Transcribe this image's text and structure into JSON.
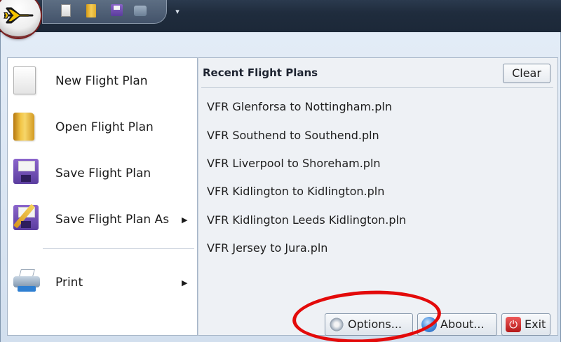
{
  "quick_access": {
    "icons": [
      "new-document-icon",
      "open-folder-icon",
      "save-disk-icon",
      "print-icon"
    ],
    "dropdown_glyph": "▾"
  },
  "app_button": {
    "icon": "airplane-icon"
  },
  "menu": {
    "items": [
      {
        "label": "New Flight Plan",
        "icon": "new-document-icon"
      },
      {
        "label": "Open Flight Plan",
        "icon": "open-folder-icon"
      },
      {
        "label": "Save Flight Plan",
        "icon": "save-disk-icon"
      },
      {
        "label": "Save Flight Plan As",
        "icon": "save-as-icon",
        "submenu_arrow": "▶"
      },
      {
        "label": "Print",
        "icon": "printer-icon",
        "submenu_arrow": "▶"
      }
    ]
  },
  "recent": {
    "header": "Recent Flight Plans",
    "clear_label": "Clear",
    "files": [
      "VFR Glenforsa to Nottingham.pln",
      "VFR Southend to Southend.pln",
      "VFR Liverpool to Shoreham.pln",
      "VFR Kidlington to Kidlington.pln",
      "VFR Kidlington Leeds Kidlington.pln",
      "VFR Jersey to Jura.pln"
    ]
  },
  "footer": {
    "options_label": "Options...",
    "about_label": "About...",
    "exit_label": "Exit"
  },
  "colors": {
    "annotation_circle": "#e30a0a",
    "frame_background": "#d2dfee",
    "title_bar": "#1f2c3d"
  }
}
